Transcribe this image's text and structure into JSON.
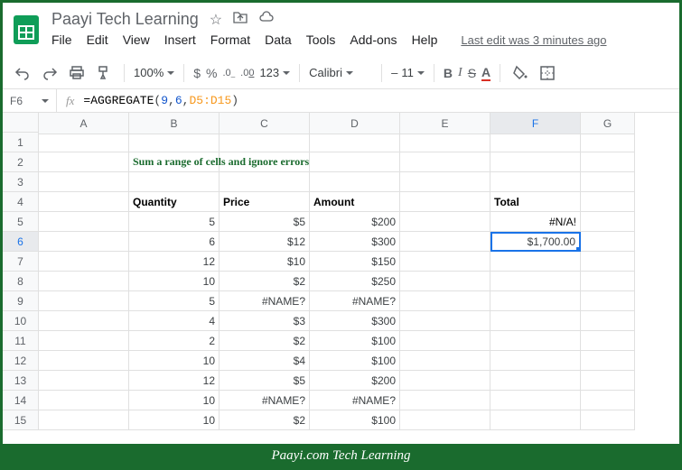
{
  "header": {
    "docname": "Paayi Tech Learning",
    "menus": [
      "File",
      "Edit",
      "View",
      "Insert",
      "Format",
      "Data",
      "Tools",
      "Add-ons",
      "Help"
    ],
    "lastedit": "Last edit was 3 minutes ago"
  },
  "toolbar": {
    "zoom": "100%",
    "font": "Calibri",
    "size": "11",
    "currency": "$",
    "percent": "%",
    "dec_dec": ".0",
    "dec_inc": ".00",
    "num_fmt": "123"
  },
  "formula": {
    "cellref": "F6",
    "text_prefix": "=AGGREGATE",
    "open": "(",
    "arg1": "9",
    "arg2": "6",
    "arg3": "D5:D15",
    "close": ")"
  },
  "sheet": {
    "title": "Sum a range of cells and ignore errors",
    "cols": [
      "A",
      "B",
      "C",
      "D",
      "E",
      "F",
      "G"
    ],
    "headers": {
      "b": "Quantity",
      "c": "Price",
      "d": "Amount",
      "f": "Total"
    },
    "rows": [
      {
        "b": "5",
        "c": "$5",
        "d": "$200",
        "f": "#N/A!"
      },
      {
        "b": "6",
        "c": "$12",
        "d": "$300",
        "f": "$1,700.00"
      },
      {
        "b": "12",
        "c": "$10",
        "d": "$150"
      },
      {
        "b": "10",
        "c": "$2",
        "d": "$250"
      },
      {
        "b": "5",
        "c": "#NAME?",
        "d": "#NAME?"
      },
      {
        "b": "4",
        "c": "$3",
        "d": "$300"
      },
      {
        "b": "2",
        "c": "$2",
        "d": "$100"
      },
      {
        "b": "10",
        "c": "$4",
        "d": "$100"
      },
      {
        "b": "12",
        "c": "$5",
        "d": "$200"
      },
      {
        "b": "10",
        "c": "#NAME?",
        "d": "#NAME?"
      },
      {
        "b": "10",
        "c": "$2",
        "d": "$100"
      }
    ]
  },
  "footer": "Paayi.com Tech Learning",
  "chart_data": {
    "type": "table",
    "title": "Sum a range of cells and ignore errors",
    "columns": [
      "Quantity",
      "Price",
      "Amount"
    ],
    "data": [
      [
        5,
        5,
        200
      ],
      [
        6,
        12,
        300
      ],
      [
        12,
        10,
        150
      ],
      [
        10,
        2,
        250
      ],
      [
        5,
        "#NAME?",
        "#NAME?"
      ],
      [
        4,
        3,
        300
      ],
      [
        2,
        2,
        100
      ],
      [
        10,
        4,
        100
      ],
      [
        12,
        5,
        200
      ],
      [
        10,
        "#NAME?",
        "#NAME?"
      ],
      [
        10,
        2,
        100
      ]
    ],
    "total_sum": "#N/A!",
    "total_aggregate": 1700.0,
    "formula": "=AGGREGATE(9,6,D5:D15)"
  }
}
